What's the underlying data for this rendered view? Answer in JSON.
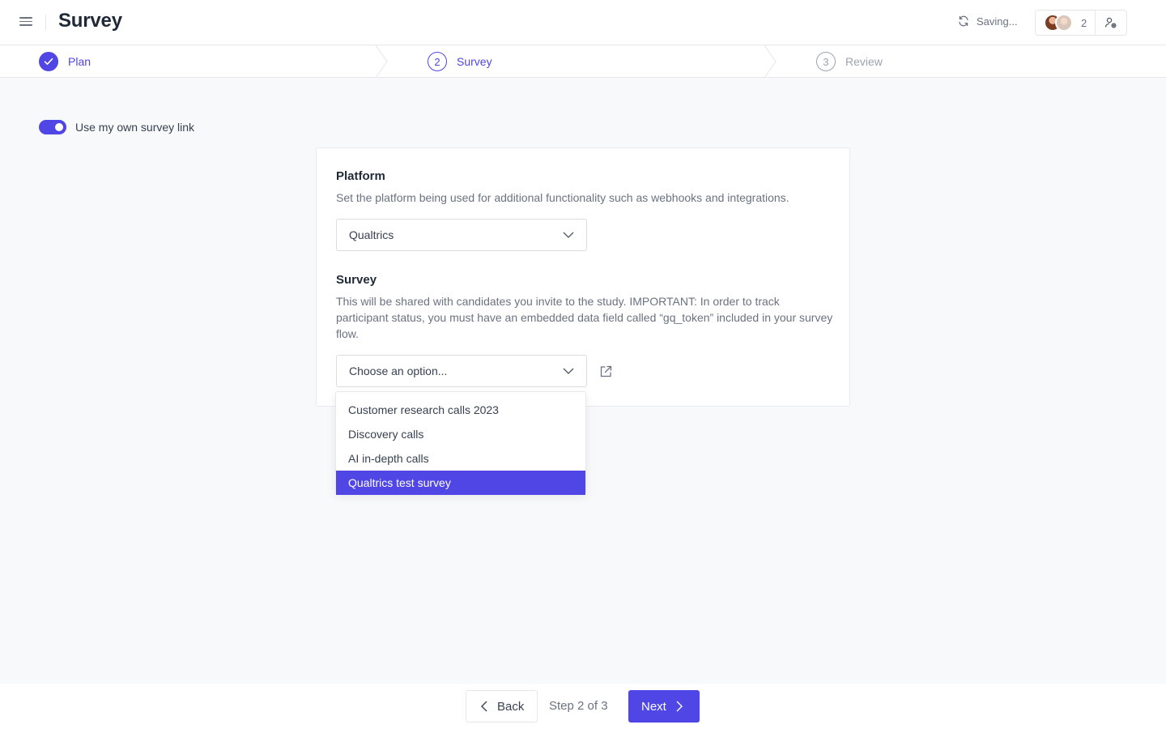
{
  "header": {
    "title": "Survey",
    "status": "Saving...",
    "collaborator_count": "2"
  },
  "stepper": {
    "steps": [
      {
        "number": "1",
        "label": "Plan",
        "state": "complete"
      },
      {
        "number": "2",
        "label": "Survey",
        "state": "current"
      },
      {
        "number": "3",
        "label": "Review",
        "state": "upcoming"
      }
    ]
  },
  "toggle": {
    "label": "Use my own survey link",
    "on": true
  },
  "platform": {
    "title": "Platform",
    "description": "Set the platform being used for additional functionality such as webhooks and integrations.",
    "selected": "Qualtrics"
  },
  "survey": {
    "title": "Survey",
    "description": "This will be shared with candidates you invite to the study. IMPORTANT: In order to track participant status, you must have an embedded data field called “gq_token” included in your survey flow.",
    "placeholder": "Choose an option...",
    "options": [
      "Customer research calls 2023",
      "Discovery calls",
      "AI in-depth calls",
      "Qualtrics test survey"
    ],
    "highlighted_option": "Qualtrics test survey"
  },
  "footer": {
    "back_label": "Back",
    "step_label": "Step 2 of 3",
    "next_label": "Next"
  },
  "colors": {
    "accent": "#4f46e5",
    "muted": "#9ca3af"
  }
}
